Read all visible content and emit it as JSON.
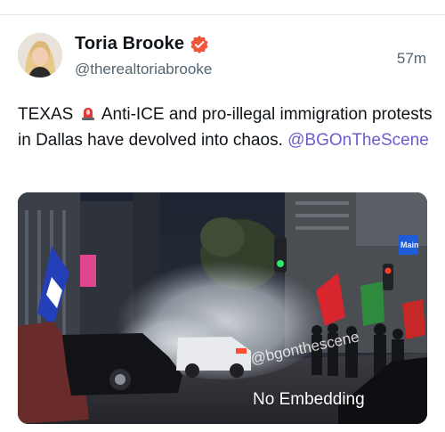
{
  "tweet": {
    "display_name": "Toria Brooke",
    "handle": "@therealtoriabrooke",
    "timestamp": "57m",
    "verified": true,
    "text_before": "TEXAS",
    "text_after": " Anti-ICE and pro-illegal immigration protests in Dallas have devolved into chaos. ",
    "mention": "@BGOnTheScene",
    "siren_icon": "police-siren-emoji"
  },
  "media": {
    "watermark": "@bgonthescene",
    "overlay_label": "No Embedding",
    "sign_label": "Main"
  },
  "colors": {
    "mention": "#6e5ccf",
    "verified_badge": "#f0553a",
    "secondary_text": "#536471"
  }
}
